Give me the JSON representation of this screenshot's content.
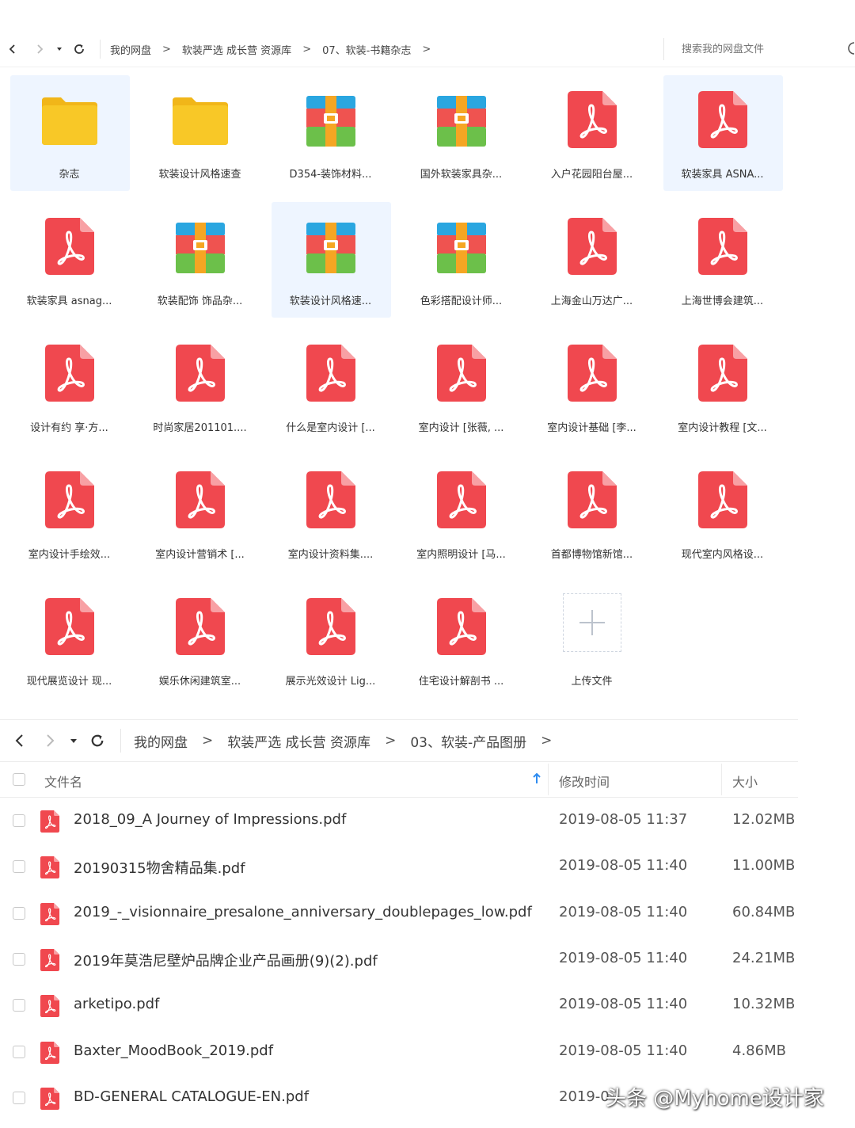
{
  "top_nav": {
    "breadcrumbs": [
      "我的网盘",
      "软装严选 成长营 资源库",
      "07、软装-书籍杂志"
    ],
    "separator": ">",
    "search_placeholder": "搜索我的网盘文件"
  },
  "grid_items": [
    {
      "label": "杂志",
      "type": "folder",
      "selected": true
    },
    {
      "label": "软装设计风格速查",
      "type": "folder",
      "selected": false
    },
    {
      "label": "D354-装饰材料...",
      "type": "archive",
      "selected": false
    },
    {
      "label": "国外软装家具杂...",
      "type": "archive",
      "selected": false
    },
    {
      "label": "入户花园阳台屋...",
      "type": "pdf",
      "selected": false
    },
    {
      "label": "软装家具 ASNA...",
      "type": "pdf",
      "selected": true
    },
    {
      "label": "软装家具 asnag...",
      "type": "pdf",
      "selected": false
    },
    {
      "label": "软装配饰  饰品杂...",
      "type": "archive",
      "selected": false
    },
    {
      "label": "软装设计风格速...",
      "type": "archive",
      "selected": true
    },
    {
      "label": "色彩搭配设计师...",
      "type": "archive",
      "selected": false
    },
    {
      "label": "上海金山万达广...",
      "type": "pdf",
      "selected": false
    },
    {
      "label": "上海世博会建筑...",
      "type": "pdf",
      "selected": false
    },
    {
      "label": "设计有约  享·方...",
      "type": "pdf",
      "selected": false
    },
    {
      "label": "时尚家居201101....",
      "type": "pdf",
      "selected": false
    },
    {
      "label": "什么是室内设计 [...",
      "type": "pdf",
      "selected": false
    },
    {
      "label": "室内设计 [张薇, ...",
      "type": "pdf",
      "selected": false
    },
    {
      "label": "室内设计基础 [李...",
      "type": "pdf",
      "selected": false
    },
    {
      "label": "室内设计教程 [文...",
      "type": "pdf",
      "selected": false
    },
    {
      "label": "室内设计手绘效...",
      "type": "pdf",
      "selected": false
    },
    {
      "label": "室内设计营销术 [...",
      "type": "pdf",
      "selected": false
    },
    {
      "label": "室内设计资料集....",
      "type": "pdf",
      "selected": false
    },
    {
      "label": "室内照明设计 [马...",
      "type": "pdf",
      "selected": false
    },
    {
      "label": "首都博物馆新馆...",
      "type": "pdf",
      "selected": false
    },
    {
      "label": "现代室内风格设...",
      "type": "pdf",
      "selected": false
    },
    {
      "label": "现代展览设计 现...",
      "type": "pdf",
      "selected": false
    },
    {
      "label": "娱乐休闲建筑室...",
      "type": "pdf",
      "selected": false
    },
    {
      "label": "展示光效设计 Lig...",
      "type": "pdf",
      "selected": false
    },
    {
      "label": "住宅设计解剖书 ...",
      "type": "pdf",
      "selected": false
    },
    {
      "label": "上传文件",
      "type": "upload",
      "selected": false
    }
  ],
  "second_nav": {
    "breadcrumbs": [
      "我的网盘",
      "软装严选 成长营 资源库",
      "03、软装-产品图册"
    ],
    "separator": ">"
  },
  "list": {
    "headers": {
      "name": "文件名",
      "modified": "修改时间",
      "size": "大小"
    },
    "sort_icon": "arrow-up-icon",
    "rows": [
      {
        "name": "2018_09_A Journey of Impressions.pdf",
        "date": "2019-08-05 11:37",
        "size": "12.02MB"
      },
      {
        "name": "20190315物舍精品集.pdf",
        "date": "2019-08-05 11:40",
        "size": "11.00MB"
      },
      {
        "name": "2019_-_visionnaire_presalone_anniversary_doublepages_low.pdf",
        "date": "2019-08-05 11:40",
        "size": "60.84MB"
      },
      {
        "name": "2019年莫浩尼壁炉品牌企业产品画册(9)(2).pdf",
        "date": "2019-08-05 11:40",
        "size": "24.21MB"
      },
      {
        "name": "arketipo.pdf",
        "date": "2019-08-05 11:40",
        "size": "10.32MB"
      },
      {
        "name": "Baxter_MoodBook_2019.pdf",
        "date": "2019-08-05 11:40",
        "size": "4.86MB"
      },
      {
        "name": "BD-GENERAL CATALOGUE-EN.pdf",
        "date": "2019-0",
        "size": ""
      }
    ]
  },
  "watermark": "头条 @Myhome设计家",
  "colors": {
    "pdf": "#f0484f",
    "folder": "#f8c827",
    "selected_bg": "#eef5ff",
    "sort_arrow": "#2f8cf0"
  }
}
